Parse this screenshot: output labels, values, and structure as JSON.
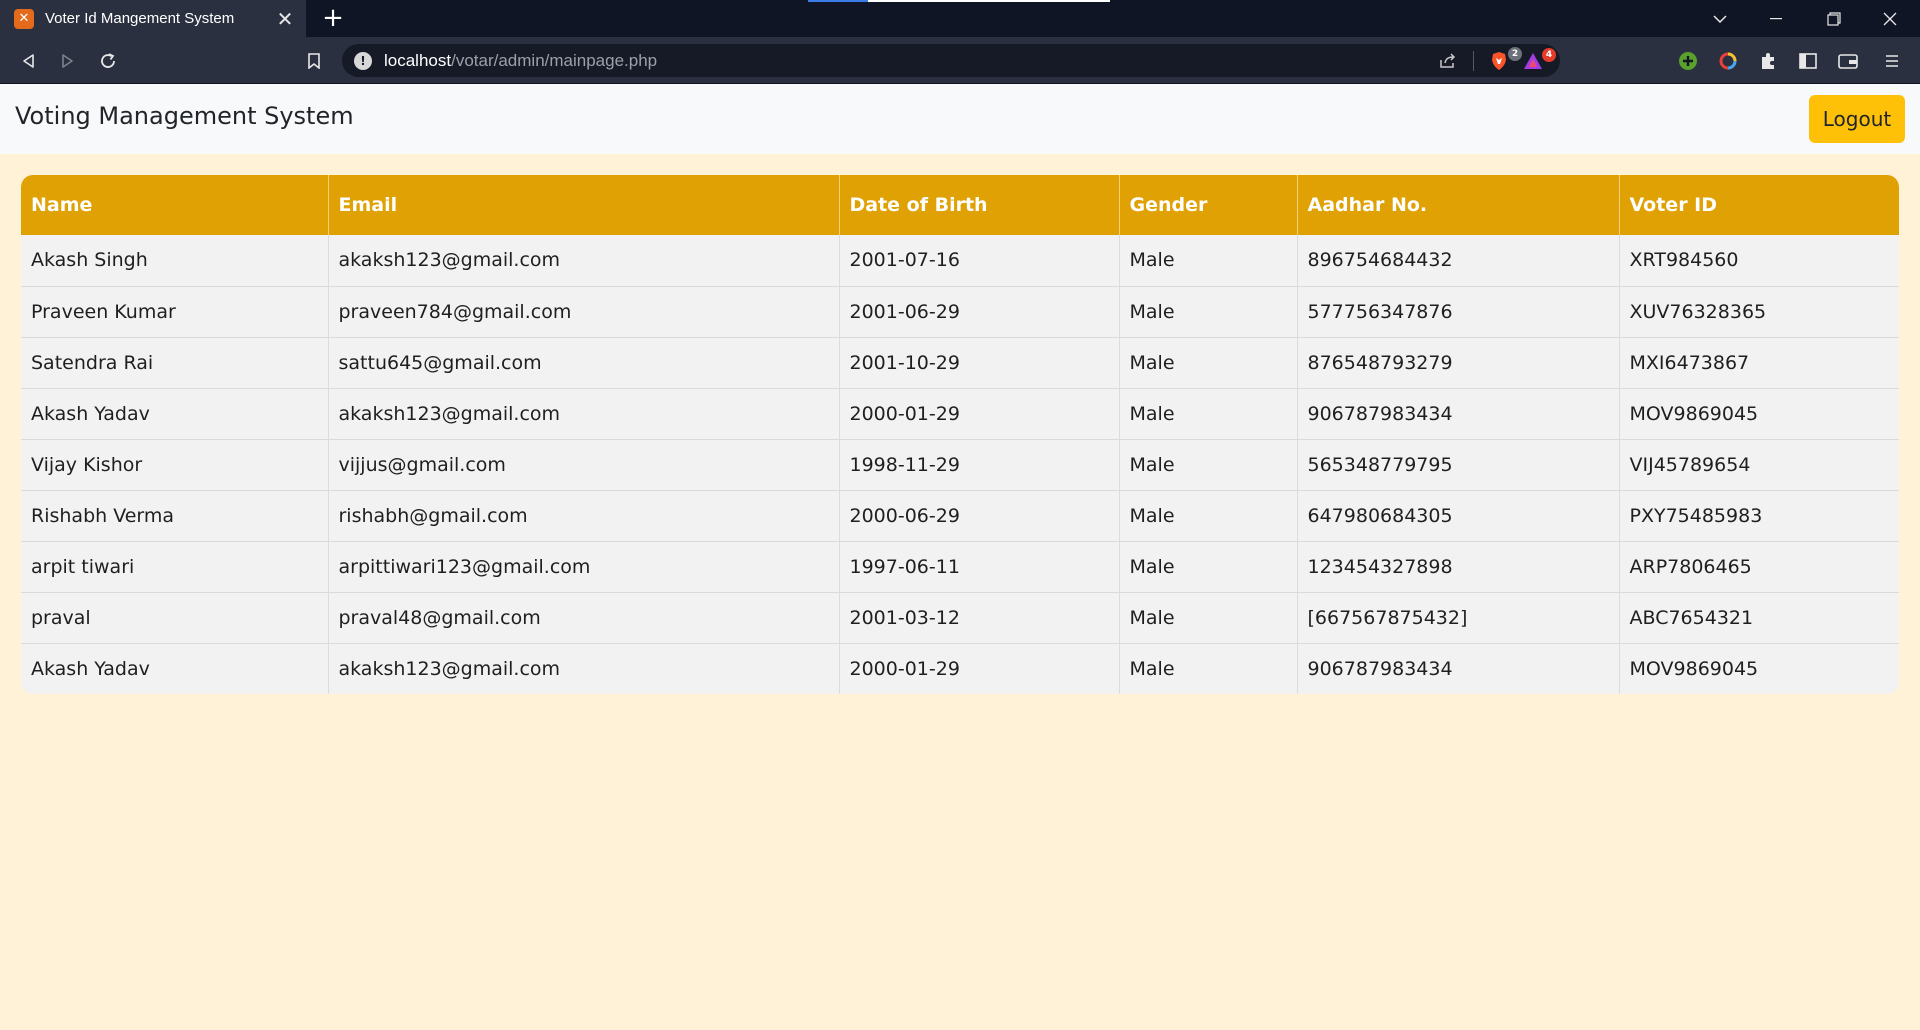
{
  "browser": {
    "tab_title": "Voter Id Mangement System",
    "tab_favicon": "xampp-icon",
    "url_host": "localhost",
    "url_path": "/votar/admin/mainpage.php",
    "brave_badge": "2",
    "rewards_badge": "4"
  },
  "navbar": {
    "brand": "Voting Management System",
    "logout_label": "Logout"
  },
  "table": {
    "headers": [
      "Name",
      "Email",
      "Date of Birth",
      "Gender",
      "Aadhar No.",
      "Voter ID"
    ],
    "rows": [
      [
        "Akash Singh",
        "akaksh123@gmail.com",
        "2001-07-16",
        "Male",
        "896754684432",
        "XRT984560"
      ],
      [
        "Praveen Kumar",
        "praveen784@gmail.com",
        "2001-06-29",
        "Male",
        "577756347876",
        "XUV76328365"
      ],
      [
        "Satendra Rai",
        "sattu645@gmail.com",
        "2001-10-29",
        "Male",
        "876548793279",
        "MXI6473867"
      ],
      [
        "Akash Yadav",
        "akaksh123@gmail.com",
        "2000-01-29",
        "Male",
        "906787983434",
        "MOV9869045"
      ],
      [
        "Vijay Kishor",
        "vijjus@gmail.com",
        "1998-11-29",
        "Male",
        "565348779795",
        "VIJ45789654"
      ],
      [
        "Rishabh Verma",
        "rishabh@gmail.com",
        "2000-06-29",
        "Male",
        "647980684305",
        "PXY75485983"
      ],
      [
        "arpit tiwari",
        "arpittiwari123@gmail.com",
        "1997-06-11",
        "Male",
        "123454327898",
        "ARP7806465"
      ],
      [
        "praval",
        "praval48@gmail.com",
        "2001-03-12",
        "Male",
        "[667567875432]",
        "ABC7654321"
      ],
      [
        "Akash Yadav",
        "akaksh123@gmail.com",
        "2000-01-29",
        "Male",
        "906787983434",
        "MOV9869045"
      ]
    ]
  },
  "colors": {
    "header_bg": "#e0a104",
    "page_bg": "#fff2d6",
    "logout_bg": "#ffc107",
    "navbar_bg": "#f8f9fa"
  }
}
